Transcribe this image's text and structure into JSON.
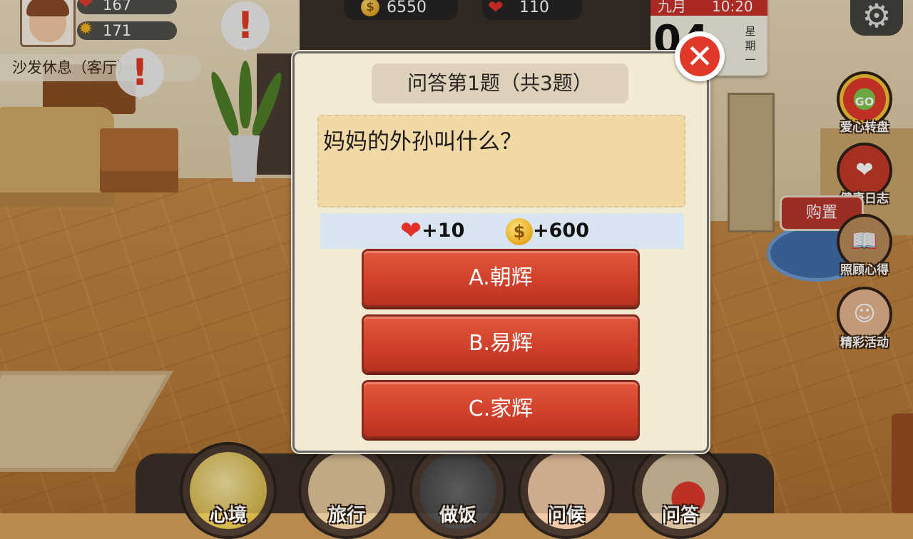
{
  "player": {
    "health": "167",
    "energy": "171",
    "location": "沙发休息（客厅）"
  },
  "currency": {
    "coins": "6550",
    "hearts": "110"
  },
  "calendar": {
    "month": "九月",
    "time": "10:20",
    "day": "04",
    "weekday": "星期一"
  },
  "side_menu": [
    {
      "label": "爱心转盘",
      "icon": "wheel-icon",
      "badge": "GO"
    },
    {
      "label": "健康日志",
      "icon": "health-log-icon"
    },
    {
      "label": "照顾心得",
      "icon": "care-notes-icon"
    },
    {
      "label": "精彩活动",
      "icon": "events-icon"
    }
  ],
  "buy_sign": "购置",
  "bottom_menu": [
    {
      "label": "心境",
      "icon": "mood-icon"
    },
    {
      "label": "旅行",
      "icon": "travel-map-icon"
    },
    {
      "label": "做饭",
      "icon": "cooking-icon"
    },
    {
      "label": "问候",
      "icon": "greeting-icon"
    },
    {
      "label": "问答",
      "icon": "quiz-icon"
    }
  ],
  "quiz": {
    "title": "问答第1题（共3题）",
    "question": "妈妈的外孙叫什么？",
    "reward_hearts": "+10",
    "reward_coins": "+600",
    "answers": [
      "A.朝辉",
      "B.易辉",
      "C.家辉"
    ]
  },
  "colors": {
    "answer_button": "#cf3f2a",
    "dialog_bg": "#f3ead4",
    "question_bg": "#f1d9a6",
    "reward_bg": "#d8e4ef",
    "close_button": "#e0392a"
  }
}
